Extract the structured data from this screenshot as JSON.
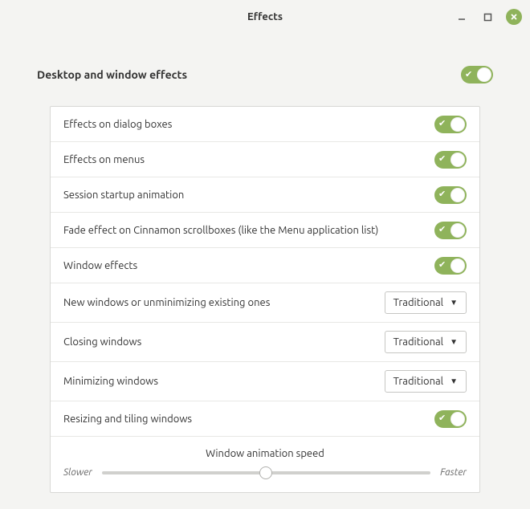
{
  "window": {
    "title": "Effects"
  },
  "header": {
    "label": "Desktop and window effects",
    "enabled": true
  },
  "rows": [
    {
      "label": "Effects on dialog boxes",
      "type": "toggle",
      "on": true
    },
    {
      "label": "Effects on menus",
      "type": "toggle",
      "on": true
    },
    {
      "label": "Session startup animation",
      "type": "toggle",
      "on": true
    },
    {
      "label": "Fade effect on Cinnamon scrollboxes (like the Menu application list)",
      "type": "toggle",
      "on": true
    },
    {
      "label": "Window effects",
      "type": "toggle",
      "on": true
    },
    {
      "label": "New windows or unminimizing existing ones",
      "type": "dropdown",
      "value": "Traditional"
    },
    {
      "label": "Closing windows",
      "type": "dropdown",
      "value": "Traditional"
    },
    {
      "label": "Minimizing windows",
      "type": "dropdown",
      "value": "Traditional"
    },
    {
      "label": "Resizing and tiling windows",
      "type": "toggle",
      "on": true
    }
  ],
  "slider": {
    "title": "Window animation speed",
    "min_label": "Slower",
    "max_label": "Faster",
    "position": 50
  },
  "colors": {
    "accent": "#8fb35b"
  }
}
